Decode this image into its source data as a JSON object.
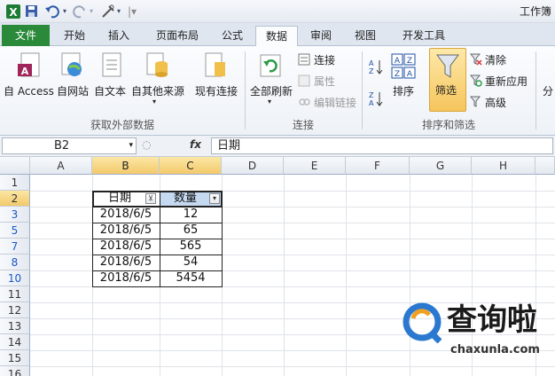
{
  "window": {
    "title": "工作簿"
  },
  "tabs": [
    {
      "label": "文件"
    },
    {
      "label": "开始"
    },
    {
      "label": "插入"
    },
    {
      "label": "页面布局"
    },
    {
      "label": "公式"
    },
    {
      "label": "数据"
    },
    {
      "label": "审阅"
    },
    {
      "label": "视图"
    },
    {
      "label": "开发工具"
    }
  ],
  "ribbon": {
    "external": {
      "access": "自 Access",
      "web": "自网站",
      "text": "自文本",
      "other": "自其他来源",
      "existing": "现有连接",
      "group_label": "获取外部数据"
    },
    "connections": {
      "refresh_all": "全部刷新",
      "connections": "连接",
      "properties": "属性",
      "edit_links": "编辑链接",
      "group_label": "连接"
    },
    "sort_filter": {
      "sort": "排序",
      "filter": "筛选",
      "clear": "清除",
      "reapply": "重新应用",
      "advanced": "高级",
      "group_label": "排序和筛选"
    },
    "more": "分"
  },
  "formula_bar": {
    "name_box": "B2",
    "fx": "fx",
    "formula": "日期"
  },
  "columns": [
    "A",
    "B",
    "C",
    "D",
    "E",
    "F",
    "G",
    "H"
  ],
  "rows": [
    "1",
    "2",
    "3",
    "5",
    "7",
    "8",
    "10",
    "11",
    "12",
    "13",
    "14",
    "15",
    "16"
  ],
  "table": {
    "headers": [
      "日期",
      "数量"
    ],
    "data": [
      [
        "2018/6/5",
        "12"
      ],
      [
        "2018/6/5",
        "65"
      ],
      [
        "2018/6/5",
        "565"
      ],
      [
        "2018/6/5",
        "54"
      ],
      [
        "2018/6/5",
        "5454"
      ]
    ]
  },
  "watermark": {
    "text": "查询啦",
    "url": "chaxunla.com"
  },
  "colors": {
    "file_tab": "#2a8a3a",
    "selection": "#f3c96b",
    "row_filtered": "#1a56c7"
  }
}
